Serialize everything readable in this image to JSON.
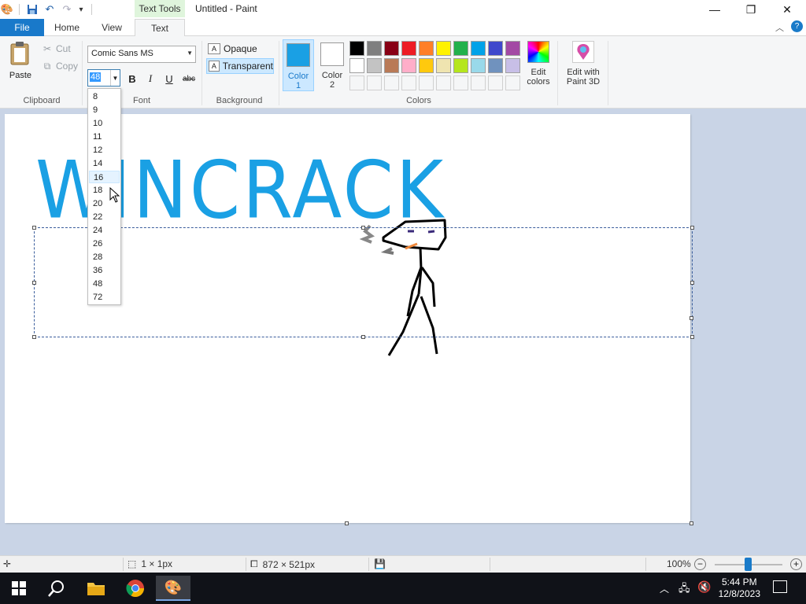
{
  "window": {
    "title": "Untitled - Paint",
    "contextual_tab_label": "Text Tools",
    "minimize": "—",
    "restore": "❐",
    "close": "✕"
  },
  "tabs": [
    {
      "label": "File",
      "active": false
    },
    {
      "label": "Home",
      "active": false
    },
    {
      "label": "View",
      "active": false
    },
    {
      "label": "Text",
      "active": true
    }
  ],
  "clipboard": {
    "group_label": "Clipboard",
    "paste": "Paste",
    "cut": "Cut",
    "copy": "Copy"
  },
  "font": {
    "group_label": "Font",
    "family": "Comic Sans MS",
    "size": "48",
    "bold": "B",
    "italic": "I",
    "underline": "U",
    "strike": "abc"
  },
  "background": {
    "group_label": "Background",
    "opaque": "Opaque",
    "transparent": "Transparent",
    "selected": "Transparent"
  },
  "colors": {
    "group_label": "Colors",
    "color1_label": "Color 1",
    "color1_value": "#1aa0e4",
    "color2_label": "Color 2",
    "color2_value": "#ffffff",
    "edit_colors": "Edit colors",
    "edit_paint3d": "Edit with Paint 3D",
    "palette_row1": [
      "#000000",
      "#7f7f7f",
      "#880015",
      "#ed1c24",
      "#ff7f27",
      "#fff200",
      "#22b14c",
      "#00a2e8",
      "#3f48cc",
      "#a349a4"
    ],
    "palette_row2": [
      "#ffffff",
      "#c3c3c3",
      "#b97a57",
      "#ffaec9",
      "#ffc90e",
      "#efe4b0",
      "#b5e61d",
      "#99d9ea",
      "#7092be",
      "#c8bfe7"
    ]
  },
  "font_size_dropdown": {
    "options": [
      "8",
      "9",
      "10",
      "11",
      "12",
      "14",
      "16",
      "18",
      "20",
      "22",
      "24",
      "26",
      "28",
      "36",
      "48",
      "72"
    ],
    "highlighted": "16"
  },
  "canvas": {
    "text": "WINCRACK",
    "text_color": "#1aa0e4"
  },
  "status": {
    "selection_size": "1 × 1px",
    "canvas_size": "872 × 521px",
    "zoom": "100%"
  },
  "taskbar": {
    "time": "5:44 PM",
    "date": "12/8/2023"
  }
}
